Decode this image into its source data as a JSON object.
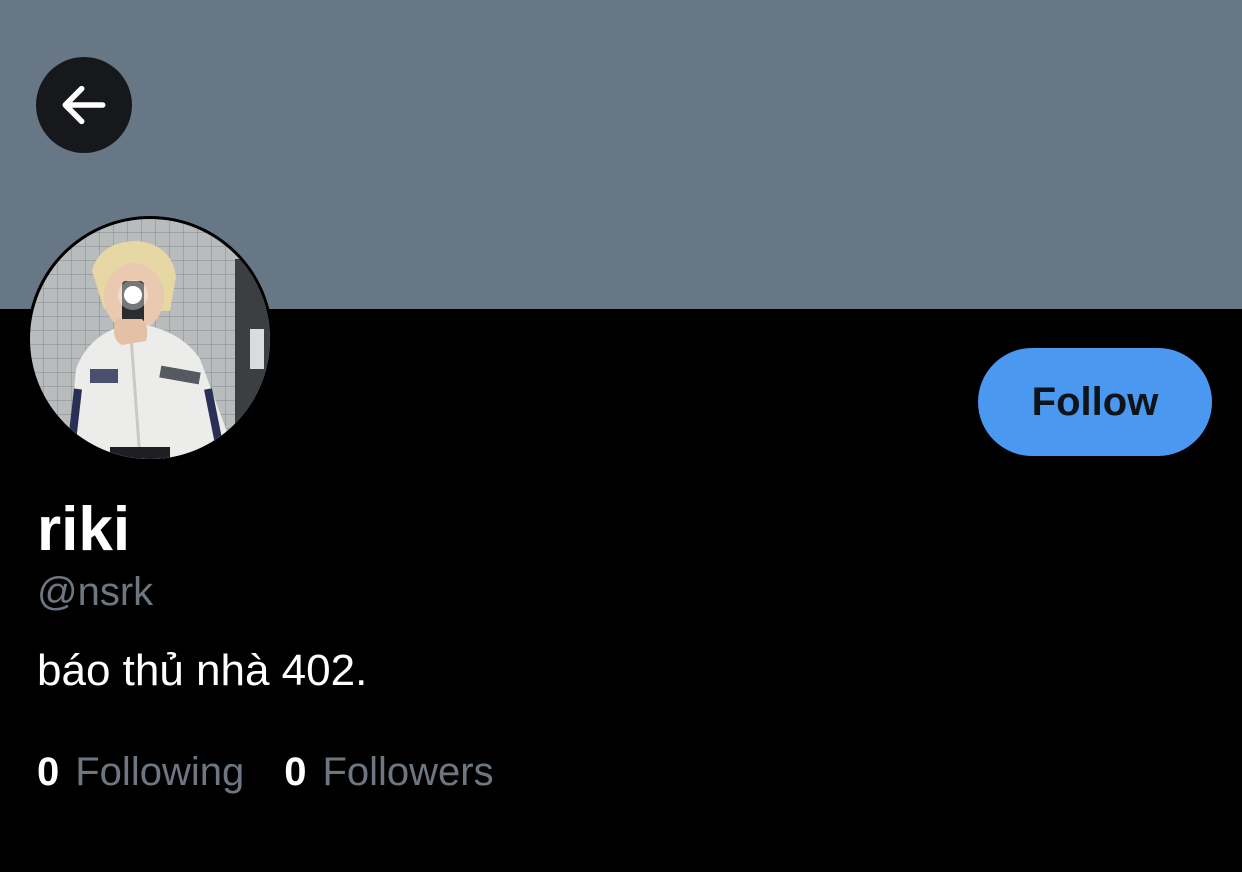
{
  "header": {
    "banner_color": "#687786",
    "back_icon": "arrow-left-icon"
  },
  "profile": {
    "avatar_icon": "profile-photo",
    "display_name": "riki",
    "handle": "@nsrk",
    "bio": "báo thủ nhà 402.",
    "follow_label": "Follow",
    "follow_color": "#4b98f0"
  },
  "stats": {
    "following_count": "0",
    "following_label": "Following",
    "followers_count": "0",
    "followers_label": "Followers"
  }
}
